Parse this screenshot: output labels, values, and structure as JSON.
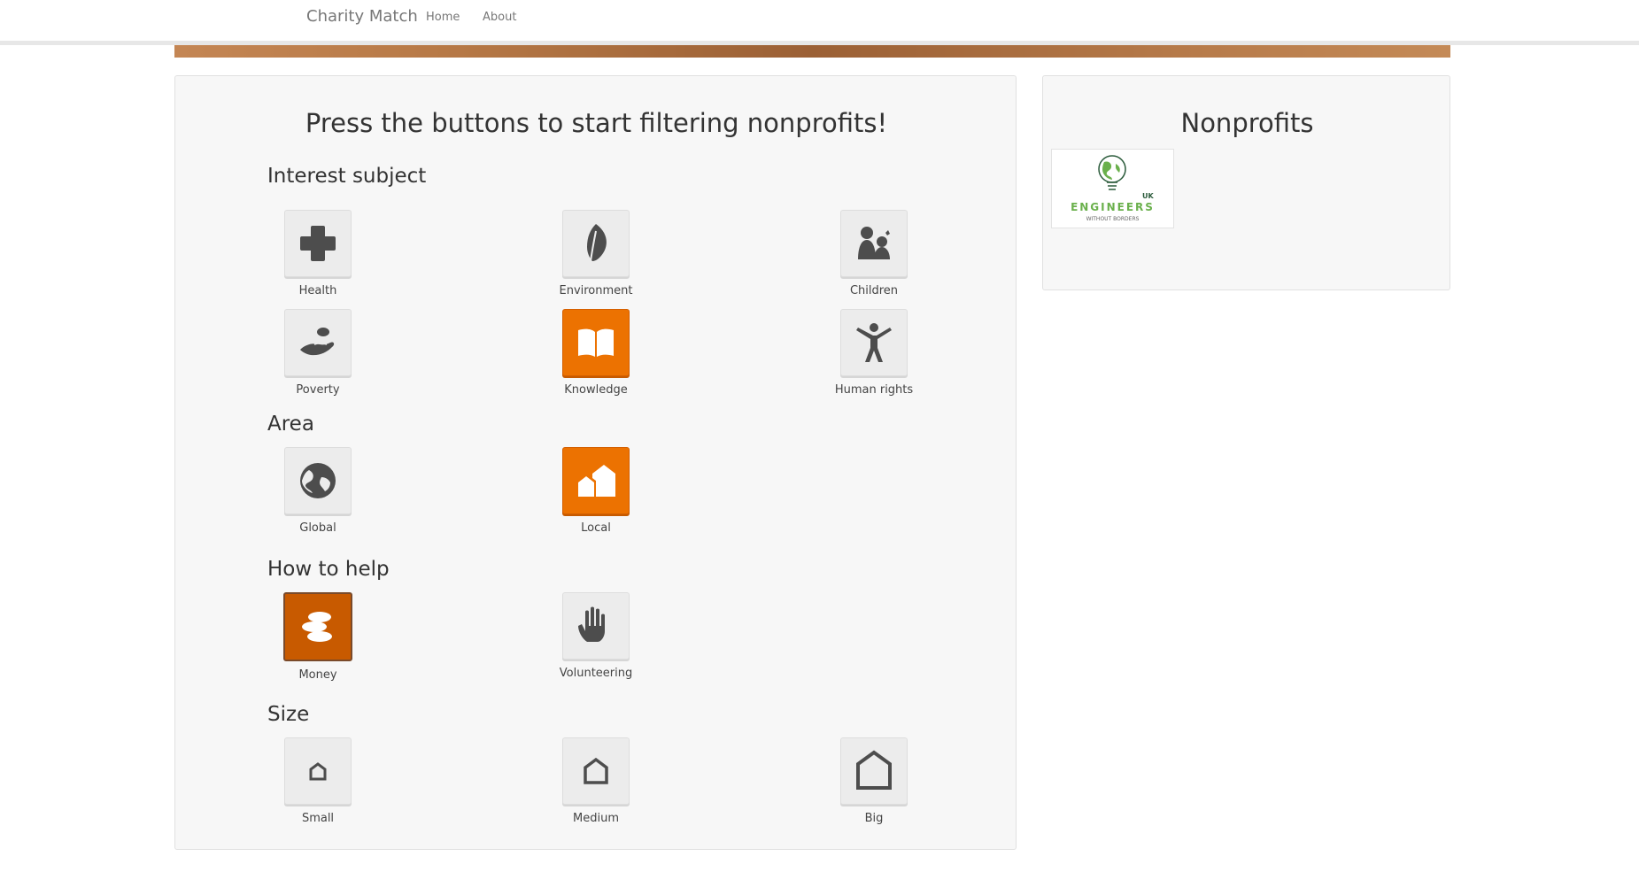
{
  "nav": {
    "brand": "Charity Match",
    "links": [
      "Home",
      "About"
    ]
  },
  "filter_panel": {
    "title": "Press the buttons to start filtering nonprofits!",
    "sections": [
      {
        "title": "Interest subject",
        "filters": [
          {
            "label": "Health",
            "icon": "health-cross-icon",
            "state": "inactive"
          },
          {
            "label": "Environment",
            "icon": "leaf-icon",
            "state": "inactive"
          },
          {
            "label": "Children",
            "icon": "children-icon",
            "state": "inactive"
          },
          {
            "label": "Poverty",
            "icon": "hand-coin-icon",
            "state": "inactive"
          },
          {
            "label": "Knowledge",
            "icon": "open-book-icon",
            "state": "active"
          },
          {
            "label": "Human rights",
            "icon": "person-arms-up-icon",
            "state": "inactive"
          }
        ]
      },
      {
        "title": "Area",
        "filters": [
          {
            "label": "Global",
            "icon": "globe-icon",
            "state": "inactive"
          },
          {
            "label": "Local",
            "icon": "houses-icon",
            "state": "active"
          }
        ]
      },
      {
        "title": "How to help",
        "filters": [
          {
            "label": "Money",
            "icon": "coins-icon",
            "state": "active-focused"
          },
          {
            "label": "Volunteering",
            "icon": "hand-raised-icon",
            "state": "inactive"
          }
        ]
      },
      {
        "title": "Size",
        "filters": [
          {
            "label": "Small",
            "icon": "house-outline-small-icon",
            "state": "inactive"
          },
          {
            "label": "Medium",
            "icon": "house-outline-medium-icon",
            "state": "inactive"
          },
          {
            "label": "Big",
            "icon": "house-outline-big-icon",
            "state": "inactive"
          }
        ]
      }
    ]
  },
  "nonprofits_panel": {
    "title": "Nonprofits",
    "results": [
      {
        "name": "ENGINEERS",
        "sub": "WITHOUT BORDERS",
        "tag": "UK",
        "icon": "lightbulb-globe-logo"
      }
    ]
  },
  "colors": {
    "active": "#ec7201",
    "focused": "#c85a00",
    "icon": "#4d4d4d",
    "logo_green": "#6ab04c"
  }
}
